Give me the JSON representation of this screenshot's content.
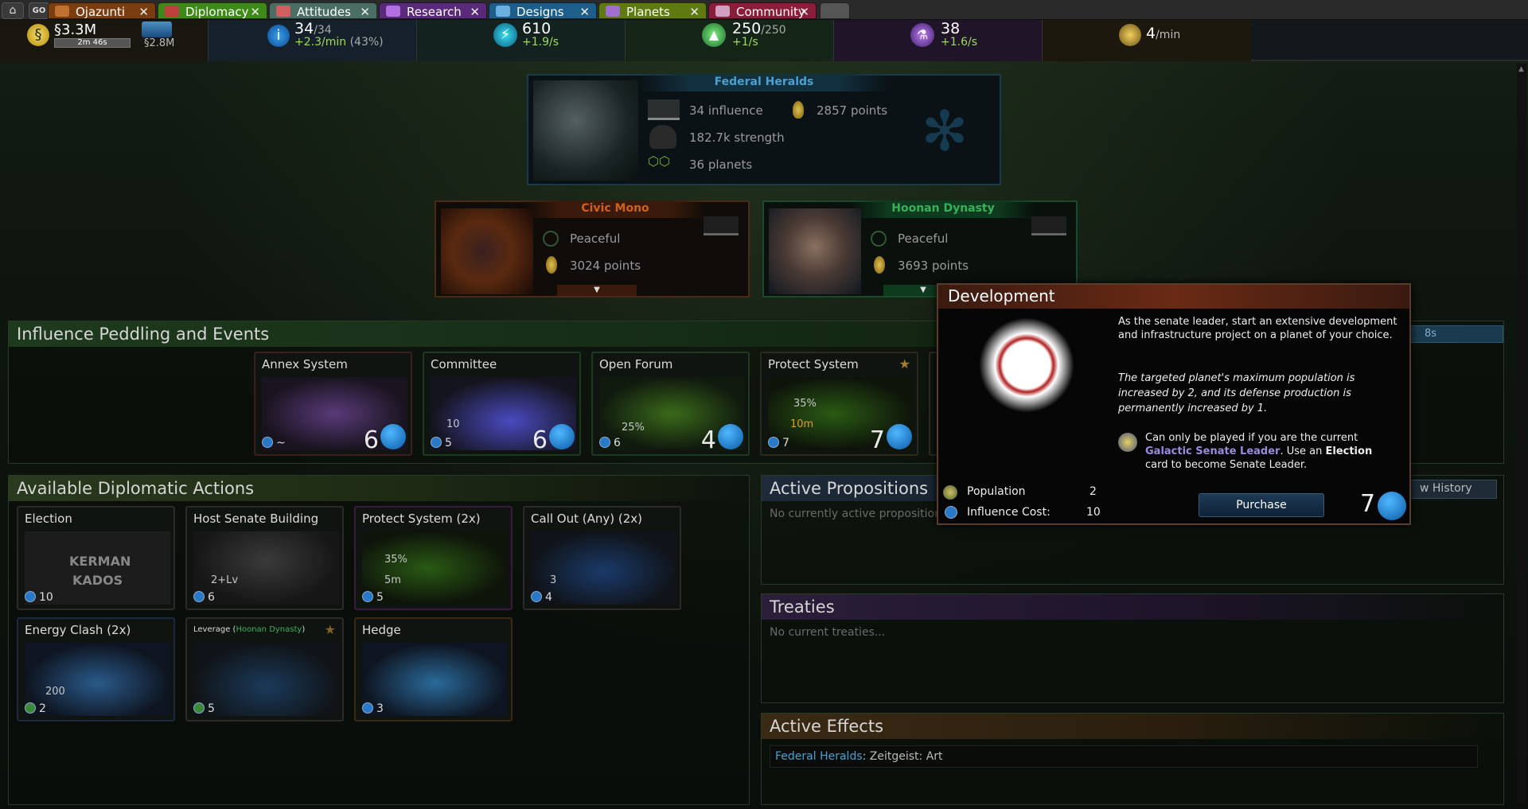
{
  "tabs": {
    "home_icon": "home-icon",
    "go": "GO",
    "items": [
      {
        "label": "Ojazunti",
        "color": "#7a3d10"
      },
      {
        "label": "Diplomacy",
        "color": "#3e8a18"
      },
      {
        "label": "Attitudes",
        "color": "#4a6e64"
      },
      {
        "label": "Research",
        "color": "#5a2a7a"
      },
      {
        "label": "Designs",
        "color": "#1e5e8a"
      },
      {
        "label": "Planets",
        "color": "#5e7a10"
      },
      {
        "label": "Community",
        "color": "#8a1e3a"
      }
    ]
  },
  "resources": {
    "money": {
      "value": "§3.3M",
      "timer": "2m 46s",
      "income": "§2.8M"
    },
    "influence": {
      "value": "34",
      "max": "/34",
      "rate": "+2.3/min",
      "pct": "(43%)"
    },
    "energy": {
      "value": "610",
      "rate": "+1.9/s"
    },
    "ftl": {
      "value": "250",
      "max": "/250",
      "rate": "+1/s"
    },
    "research": {
      "value": "38",
      "rate": "+1.6/s"
    },
    "defense": {
      "value": "4",
      "unit": "/min"
    }
  },
  "empires": {
    "top": {
      "name": "Federal Heralds",
      "influence": "34 influence",
      "points": "2857 points",
      "strength": "182.7k strength",
      "planets": "36 planets"
    },
    "left": {
      "name": "Civic Mono",
      "attitude": "Peaceful",
      "points": "3024 points"
    },
    "right": {
      "name": "Hoonan Dynasty",
      "attitude": "Peaceful",
      "points": "3693 points"
    }
  },
  "influence_section": {
    "title": "Influence Peddling and Events",
    "timer": "8s",
    "cards": [
      {
        "title": "Annex System",
        "cost": "~",
        "big": "6"
      },
      {
        "title": "Committee",
        "cost": "5",
        "big": "6",
        "extra": "10"
      },
      {
        "title": "Open Forum",
        "cost": "6",
        "big": "4",
        "extra": "25%"
      },
      {
        "title": "Protect System",
        "cost": "7",
        "big": "7",
        "extra": "35%",
        "extra2": "10m"
      }
    ]
  },
  "actions_section": {
    "title": "Available Diplomatic Actions",
    "cards": [
      {
        "title": "Election",
        "cost": "10",
        "art_text1": "KERMAN",
        "art_text2": "KADOS"
      },
      {
        "title": "Host Senate Building",
        "cost": "6",
        "extra": "2+Lv"
      },
      {
        "title": "Protect System (2x)",
        "cost": "5",
        "extra": "35%",
        "extra2": "5m"
      },
      {
        "title": "Call Out (Any) (2x)",
        "cost": "4",
        "extra": "3"
      },
      {
        "title": "Energy Clash (2x)",
        "cost": "2",
        "extra": "200"
      },
      {
        "title": "Leverage",
        "title_empire": "Hoonan Dynasty",
        "cost": "5"
      },
      {
        "title": "Hedge",
        "cost": "3"
      }
    ]
  },
  "propositions": {
    "title": "Active Propositions",
    "empty": "No currently active proposition",
    "history_btn": "w History"
  },
  "treaties": {
    "title": "Treaties",
    "empty": "No current treaties..."
  },
  "effects": {
    "title": "Active Effects",
    "empire": "Federal Heralds",
    "effect": ": Zeitgeist: Art"
  },
  "popup": {
    "title": "Development",
    "desc": "As the senate leader, start an extensive development and infrastructure project on a planet of your choice.",
    "italic": "The targeted planet's maximum population is increased by 2, and its defense production is permanently increased by 1.",
    "req_pre": "Can only be played if you are the current",
    "req_leader": "Galactic Senate Leader",
    "req_mid": ". Use an",
    "req_card": "Election",
    "req_post": "card to become Senate Leader.",
    "pop_label": "Population",
    "pop_value": "2",
    "cost_label": "Influence Cost:",
    "cost_value": "10",
    "purchase": "Purchase",
    "big": "7"
  }
}
